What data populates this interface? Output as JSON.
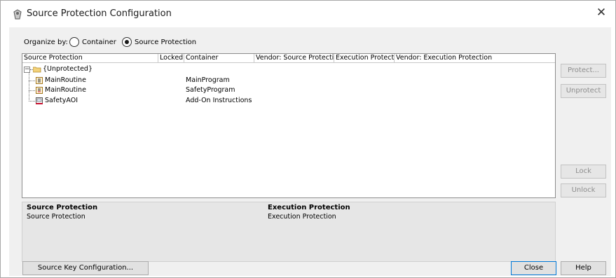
{
  "window": {
    "title": "Source Protection Configuration",
    "close_glyph": "✕"
  },
  "organize": {
    "label": "Organize by:",
    "options": [
      {
        "label": "Container",
        "selected": false
      },
      {
        "label": "Source Protection",
        "selected": true
      }
    ]
  },
  "table": {
    "columns": [
      "Source Protection",
      "Locked",
      "Container",
      "Vendor: Source Protection",
      "Execution Protection",
      "Vendor: Execution Protection"
    ],
    "root": {
      "label": "{Unprotected}",
      "expander": "−"
    },
    "rows": [
      {
        "name": "MainRoutine",
        "locked": "",
        "container": "MainProgram",
        "icon": "routine-icon"
      },
      {
        "name": "MainRoutine",
        "locked": "",
        "container": "SafetyProgram",
        "icon": "routine-icon"
      },
      {
        "name": "SafetyAOI",
        "locked": "",
        "container": "Add-On Instructions",
        "icon": "aoi-icon"
      }
    ]
  },
  "details": {
    "source_heading": "Source Protection",
    "source_value": "Source Protection",
    "exec_heading": "Execution Protection",
    "exec_value": "Execution Protection"
  },
  "buttons": {
    "protect": "Protect...",
    "unprotect": "Unprotect",
    "lock": "Lock",
    "unlock": "Unlock",
    "source_key": "Source Key Configuration...",
    "close": "Close",
    "help": "Help"
  },
  "colors": {
    "window_bg": "#f0f0f0",
    "default_button_border": "#0078d7",
    "disabled_text": "#8d8d8d"
  }
}
